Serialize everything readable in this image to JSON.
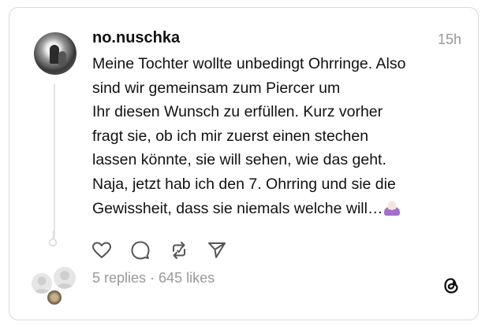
{
  "post": {
    "username": "no.nuschka",
    "time": "15h",
    "lines": [
      "Meine Tochter wollte unbedingt Ohrringe. Also",
      "sind wir gemeinsam zum Piercer um",
      "Ihr diesen Wunsch zu erfüllen. Kurz vorher",
      "fragt sie, ob ich mir zuerst einen stechen",
      "lassen könnte, sie will sehen, wie das geht.",
      "Naja, jetzt hab ich den 7. Ohrring und sie die",
      "Gewissheit, dass sie niemals welche will…"
    ],
    "emoji": "woman-shrugging-emoji"
  },
  "actions": {
    "like": "heart-icon",
    "reply": "comment-icon",
    "repost": "repost-icon",
    "share": "send-icon"
  },
  "stats": {
    "replies": "5 replies",
    "separator": " · ",
    "likes": "645 likes"
  },
  "logo": "threads-logo-icon",
  "colors": {
    "text": "#111111",
    "muted": "#999999",
    "border": "#d9d9d9"
  }
}
